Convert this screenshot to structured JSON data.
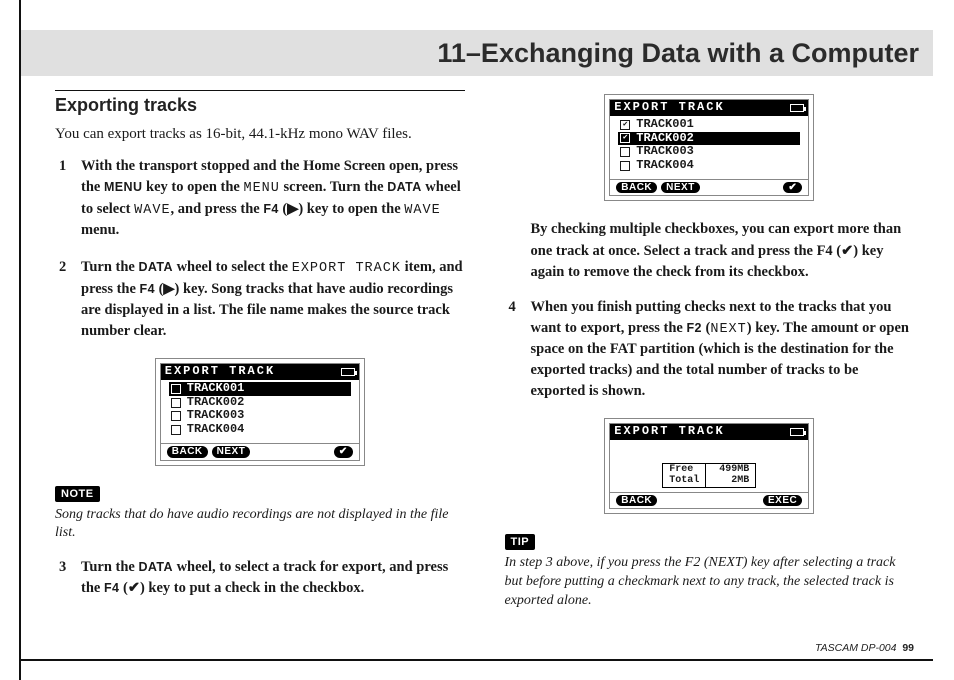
{
  "page": {
    "chapter_title": "11–Exchanging Data with a Computer",
    "footer_product": "TASCAM  DP-004",
    "footer_page": "99"
  },
  "section": {
    "heading": "Exporting tracks",
    "intro": "You can export tracks as 16-bit, 44.1-kHz mono WAV files."
  },
  "steps": {
    "s1_a": "With the transport stopped and the Home Screen open, press the ",
    "s1_key1": "MENU",
    "s1_b": " key to open the ",
    "s1_lcd1": "MENU",
    "s1_c": " screen. Turn the ",
    "s1_key2": "DATA",
    "s1_d": " wheel to select ",
    "s1_lcd2": "WAVE",
    "s1_e": ", and press the ",
    "s1_key3": "F4",
    "s1_f": " (▶) key to open the ",
    "s1_lcd3": "WAVE",
    "s1_g": " menu.",
    "s2_a": "Turn the ",
    "s2_key1": "DATA",
    "s2_b": " wheel to select the ",
    "s2_lcd1": "EXPORT TRACK",
    "s2_c": " item, and press the ",
    "s2_key2": "F4",
    "s2_d": " (▶) key. Song tracks that have audio recordings are displayed in a list. The file name makes the source track number clear.",
    "s3_a": "Turn the ",
    "s3_key1": "DATA",
    "s3_b": " wheel, to select a track for export, and press the ",
    "s3_key2": "F4",
    "s3_c": " (✔) key to put a check in the checkbox.",
    "para_a": "By checking multiple checkboxes, you can export more than one track at once. Select a track and press the F4 (✔) key again to remove the check from its checkbox.",
    "s4_a": "When you finish putting checks next to the tracks that you want to export, press the ",
    "s4_key1": "F2",
    "s4_b": " (",
    "s4_lcd1": "NEXT",
    "s4_c": ") key. The amount or open space on the FAT partition (which is the destination for the exported tracks) and the total number of tracks to be exported is shown."
  },
  "note": {
    "label": "NOTE",
    "text": "Song tracks that do have audio recordings are not displayed in the file list."
  },
  "tip": {
    "label": "TIP",
    "text": "In step 3 above, if you press the F2 (NEXT) key after selecting a track but before putting a checkmark next to any track, the selected track is exported alone."
  },
  "lcd1": {
    "title": "EXPORT TRACK",
    "tracks": [
      "TRACK001",
      "TRACK002",
      "TRACK003",
      "TRACK004"
    ],
    "back": "BACK",
    "next": "NEXT",
    "check": "✔"
  },
  "lcd2": {
    "title": "EXPORT TRACK",
    "tracks": [
      "TRACK001",
      "TRACK002",
      "TRACK003",
      "TRACK004"
    ],
    "back": "BACK",
    "next": "NEXT",
    "check": "✔"
  },
  "lcd3": {
    "title": "EXPORT TRACK",
    "free_label": "Free",
    "free_val": "499MB",
    "total_label": "Total",
    "total_val": "2MB",
    "back": "BACK",
    "exec": "EXEC"
  }
}
